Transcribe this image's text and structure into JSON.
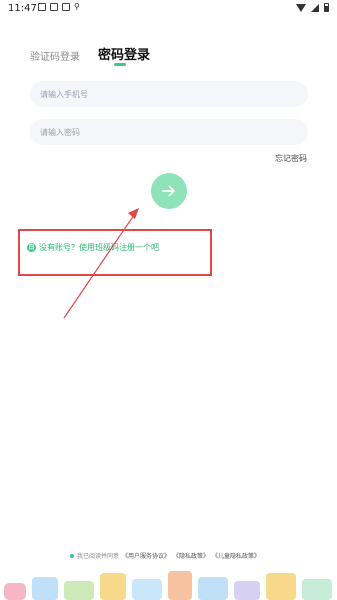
{
  "status_bar": {
    "time": "11:47"
  },
  "tabs": {
    "sms_login": "验证码登录",
    "password_login": "密码登录"
  },
  "form": {
    "phone_placeholder": "请输入手机号",
    "password_placeholder": "请输入密码",
    "forgot_password": "忘记密码"
  },
  "register": {
    "badge": "白",
    "text": "没有账号？使用班级码注册一个吧"
  },
  "agreement": {
    "prefix": "我已阅读并同意",
    "service": "《用户服务协议》",
    "privacy": "《隐私政策》",
    "child_privacy": "《儿童隐私政策》"
  },
  "colors": {
    "accent": "#3cc98a",
    "submit": "#8ee3b8",
    "annotation": "#e04848"
  }
}
